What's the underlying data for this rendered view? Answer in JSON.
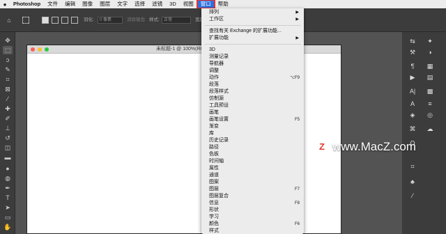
{
  "menubar": {
    "apple": "",
    "items": [
      "Photoshop",
      "文件",
      "编辑",
      "图像",
      "图层",
      "文字",
      "选择",
      "滤镜",
      "3D",
      "视图",
      "窗口",
      "帮助"
    ],
    "active_index": 10
  },
  "options": {
    "feather_label": "羽化:",
    "feather_value": "0 像素",
    "antialias": "消除锯齿",
    "style_label": "样式:",
    "style_value": "正常",
    "width_label": "宽度:"
  },
  "document": {
    "title": "未标题-1 @ 100%(RG"
  },
  "window_menu": {
    "items": [
      {
        "label": "排列",
        "submenu": true
      },
      {
        "label": "工作区",
        "submenu": true
      },
      {
        "label": "查找有关 Exchange 的扩展功能..."
      },
      {
        "label": "扩展功能",
        "submenu": true
      },
      {
        "label": "3D"
      },
      {
        "label": "测量记录"
      },
      {
        "label": "导航器"
      },
      {
        "label": "调整"
      },
      {
        "label": "动作",
        "shortcut": "⌥F9"
      },
      {
        "label": "段落"
      },
      {
        "label": "段落样式"
      },
      {
        "label": "仿制源"
      },
      {
        "label": "工具预设"
      },
      {
        "label": "画笔"
      },
      {
        "label": "画笔设置",
        "shortcut": "F5"
      },
      {
        "label": "渐变"
      },
      {
        "label": "库"
      },
      {
        "label": "历史记录"
      },
      {
        "label": "路径"
      },
      {
        "label": "色板"
      },
      {
        "label": "时间轴"
      },
      {
        "label": "属性"
      },
      {
        "label": "通道"
      },
      {
        "label": "图案"
      },
      {
        "label": "图层",
        "shortcut": "F7"
      },
      {
        "label": "图层复合"
      },
      {
        "label": "信息",
        "shortcut": "F8"
      },
      {
        "label": "形状"
      },
      {
        "label": "学习"
      },
      {
        "label": "颜色",
        "shortcut": "F6"
      },
      {
        "label": "样式"
      }
    ]
  },
  "watermark": {
    "logo": "Z",
    "text": "www.MacZ.com"
  },
  "colors": {
    "menubar_bg": "#ececec",
    "active_menu": "#2f6fe0",
    "highlight_border": "#e0322e",
    "workspace": "#535353",
    "panel": "#3c3c3c",
    "traffic_red": "#fe5f57",
    "traffic_yellow": "#febc2e",
    "traffic_green": "#28c840"
  },
  "icons": {
    "tools": [
      "move-icon",
      "marquee-icon",
      "lasso-icon",
      "quick-select-icon",
      "crop-icon",
      "frame-icon",
      "eyedropper-icon",
      "healing-icon",
      "brush-icon",
      "stamp-icon",
      "history-brush-icon",
      "eraser-icon",
      "gradient-icon",
      "blur-icon",
      "dodge-icon",
      "pen-icon",
      "type-icon",
      "path-select-icon",
      "rectangle-icon",
      "hand-icon"
    ]
  }
}
